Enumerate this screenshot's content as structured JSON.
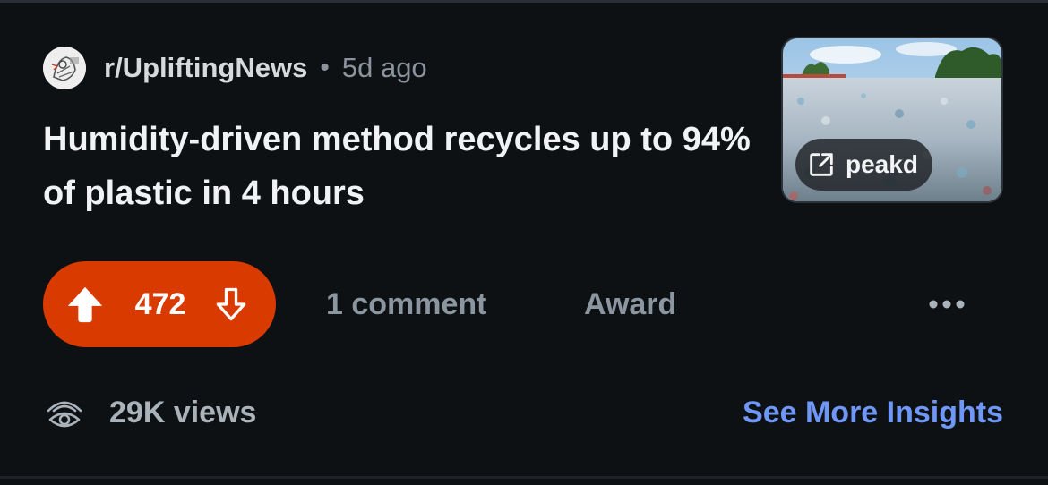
{
  "post": {
    "subreddit": "r/UpliftingNews",
    "separator": "•",
    "age": "5d ago",
    "title": "Humidity-driven method recycles up to 94% of plastic in 4 hours",
    "thumbnail": {
      "domain_label": "peakd",
      "link_icon": "external-link-icon"
    }
  },
  "actions": {
    "upvote_icon": "upvote-arrow-icon",
    "score": "472",
    "downvote_icon": "downvote-arrow-icon",
    "comments_label": "1 comment",
    "award_label": "Award",
    "more_icon": "more-options-icon"
  },
  "stats": {
    "views_icon": "views-eye-icon",
    "views_label": "29K views",
    "insights_link": "See More Insights"
  },
  "colors": {
    "background": "#0e1114",
    "vote_active": "#d93a00",
    "link_blue": "#6f97f7"
  }
}
